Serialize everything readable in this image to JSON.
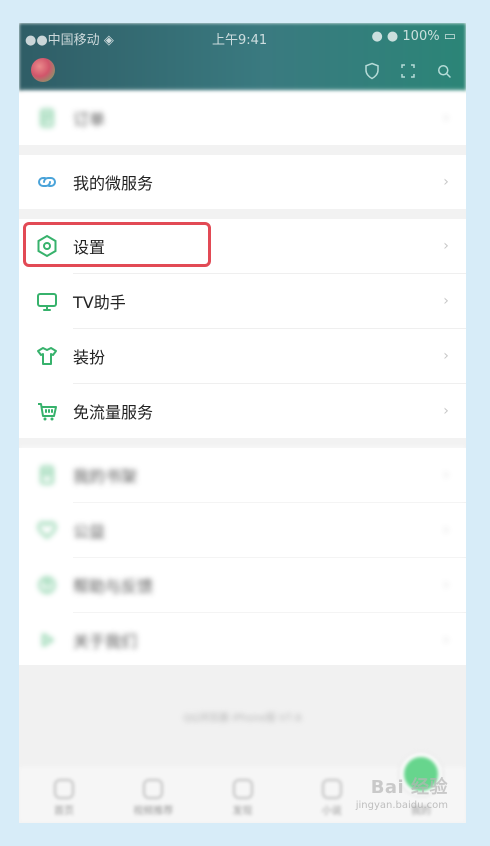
{
  "colors": {
    "accent_green": "#37b26c",
    "highlight_red": "#e24a55",
    "header_teal": "#2f5d66",
    "menu_text": "#222222",
    "divider_gap": "#f2f2f2"
  },
  "status_bar": {
    "left": "●●中国移动 ◈",
    "center": "上午9:41",
    "right": "● ● 100% ▭"
  },
  "menu": {
    "items": [
      {
        "label": "订单",
        "icon": "receipt-icon",
        "blurred": true
      },
      {
        "label": "我的微服务",
        "icon": "link-icon",
        "blurred": false
      },
      {
        "label": "设置",
        "icon": "settings-hexagon-icon",
        "blurred": false
      },
      {
        "label": "TV助手",
        "icon": "tv-icon",
        "blurred": false
      },
      {
        "label": "装扮",
        "icon": "tshirt-icon",
        "blurred": false
      },
      {
        "label": "免流量服务",
        "icon": "cart-icon",
        "blurred": false
      },
      {
        "label": "我的书架",
        "icon": "book-icon",
        "blurred": true
      },
      {
        "label": "公益",
        "icon": "heart-icon",
        "blurred": true
      },
      {
        "label": "帮助与反馈",
        "icon": "help-icon",
        "blurred": true
      },
      {
        "label": "关于我们",
        "icon": "play-icon",
        "blurred": true
      }
    ],
    "chevron": "›"
  },
  "footer": {
    "text": "QQ浏览器 iPhone版 V7.6"
  },
  "tabbar": {
    "tabs": [
      {
        "label": "首页"
      },
      {
        "label": "视频推荐"
      },
      {
        "label": "发现"
      },
      {
        "label": "小说"
      },
      {
        "label": "我的"
      }
    ]
  },
  "watermark": {
    "top": "Bai 经验",
    "bottom": "jingyan.baidu.com"
  }
}
